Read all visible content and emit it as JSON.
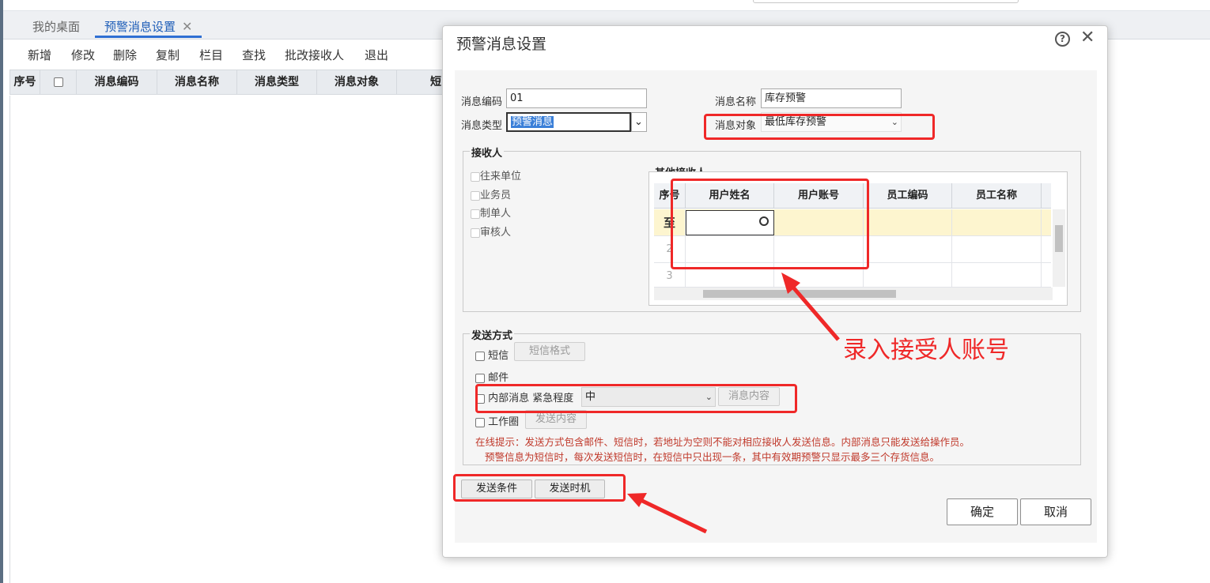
{
  "tabs": [
    {
      "label": "我的桌面"
    },
    {
      "label": "预警消息设置",
      "close": "✕"
    }
  ],
  "toolbar": [
    "新增",
    "修改",
    "删除",
    "复制",
    "栏目",
    "查找",
    "批改接收人",
    "退出"
  ],
  "grid": {
    "columns": [
      "序号",
      "消息编码",
      "消息名称",
      "消息类型",
      "消息对象",
      "短"
    ]
  },
  "dialog": {
    "title": "预警消息设置",
    "help": "?",
    "close": "✕",
    "fields": {
      "code_label": "消息编码",
      "code_value": "01",
      "name_label": "消息名称",
      "name_value": "库存预警",
      "type_label": "消息类型",
      "type_value": "预警消息",
      "object_label": "消息对象",
      "object_value": "最低库存预警"
    },
    "receivers": {
      "legend": "接收人",
      "options": [
        "往来单位",
        "业务员",
        "制单人",
        "审核人"
      ],
      "other_legend": "其他接收人",
      "columns": [
        "序号",
        "用户姓名",
        "用户账号",
        "员工编码",
        "员工名称"
      ],
      "rows": [
        {
          "num": "至"
        },
        {
          "num": "2"
        },
        {
          "num": "3"
        }
      ]
    },
    "send": {
      "legend": "发送方式",
      "sms": "短信",
      "sms_button": "短信格式",
      "email": "邮件",
      "internal": "内部消息",
      "urgency_label": "紧急程度",
      "urgency_value": "中",
      "content_button": "消息内容",
      "circle": "工作圈",
      "circle_button": "发送内容",
      "hint1": "在线提示：发送方式包含邮件、短信时，若地址为空则不能对相应接收人发送信息。内部消息只能发送给操作员。",
      "hint2": "预警信息为短信时，每次发送短信时，在短信中只出现一条，其中有效期预警只显示最多三个存货信息。"
    },
    "buttons": {
      "condition": "发送条件",
      "timing": "发送时机",
      "ok": "确定",
      "cancel": "取消"
    }
  },
  "annotation": {
    "text": "录入接受人账号",
    "color": "#ef2828"
  },
  "colors": {
    "accent": "#2f6fd3",
    "highlight_row": "#fdf5cf",
    "hint": "#c0392b"
  }
}
